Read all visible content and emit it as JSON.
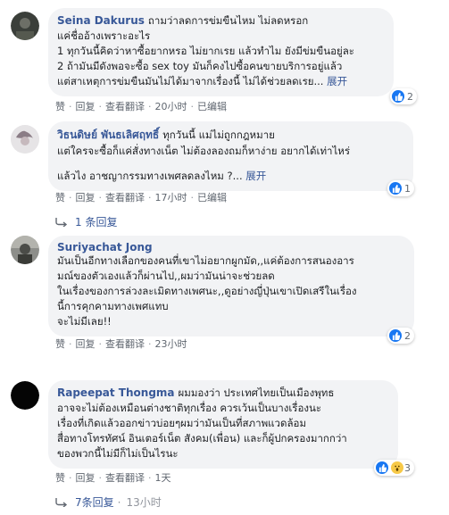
{
  "comments": [
    {
      "author": "Seina Dakurus",
      "first_line": "ถามว่าลดการข่มขืนไหม ไม่ลดหรอก",
      "lines": [
        "แค่ชื่ออ้างเพราะอะไร",
        "1 ทุกวันนี้คิดว่าหาซื้อยากหรอ ไม่ยากเรย แล้วทำไม ยังมีข่มขืนอยู่ละ",
        "2 ถ้ามันมีดังพอจะซื้อ sex toy มันก็คงไปซื้อคนขายบริการอยู่แล้ว"
      ],
      "last_line": "แต่สาเหตุการข่มขืนมันไม่ได้มาจากเรื่องนี้ ไม่ได้ช่วยลดเรย...",
      "more": "展开",
      "like": "赞",
      "reply": "回复",
      "translate": "查看翻译",
      "time": "20小时",
      "edited": "已编辑",
      "reaction_count": "2"
    },
    {
      "author": "วิธนดิษย์ พันธเลิศฤทธิ์",
      "first_line": "ทุกวันนี้ แม่ไม่ถูกกฎหมาย",
      "lines": [
        "แต่ใครจะซื้อก็แค่สั่งทางเน็ต ไม่ต้องลองถมก็หาง่าย อยากได้เท่าไหร่",
        "",
        "แล้วไง อาชญากรรมทางเพศลดลงไหม ?..."
      ],
      "more": "展开",
      "like": "赞",
      "reply": "回复",
      "translate": "查看翻译",
      "time": "17小时",
      "edited": "已编辑",
      "reaction_count": "1",
      "replies": "1 条回复"
    },
    {
      "author": "Suriyachat Jong",
      "lines": [
        "มันเป็นอีกทางเลือกของคนที่เขาไม่อยากผูกมัด,,แค่ต้องการสนองอาร",
        "มณ์ของตัวเองแล้วก็ผ่านไป,,ผมว่ามันน่าจะช่วยลด",
        "ในเรื่องของการล่วงละเมิดทางเพศนะ,,ดูอย่างญี่ปุ่นเขาเปิดเสรีในเรื่อง",
        "นี้การคุกคามทางเพศแทบ",
        "จะไม่มีเลย!!"
      ],
      "like": "赞",
      "reply": "回复",
      "translate": "查看翻译",
      "time": "23小时",
      "reaction_count": "2"
    },
    {
      "author": "Rapeepat Thongma",
      "first_line": "ผมมองว่า ประเทศไทยเป็นเมืองพุทธ",
      "lines": [
        "อาจจะไม่ต้องเหมือนต่างชาติทุกเรื่อง ควรเว้นเป็นบางเรื่องนะ",
        "เรื่องที่เกิดแล้วออกข่าวบ่อยๆผมว่ามันเป็นที่สภาพแวดล้อม",
        "สื่อทางโทรทัศน์ อินเตอร์เน็ต สังคม(เพื่อน) และก็ผู้ปกครองมากกว่า",
        "ของพวกนี้ไม่มีก็ไม่เป็นไรนะ"
      ],
      "like": "赞",
      "reply": "回复",
      "translate": "查看翻译",
      "time": "1天",
      "reaction_count": "3",
      "replies": "7条回复",
      "replies_time": "13小时"
    }
  ]
}
